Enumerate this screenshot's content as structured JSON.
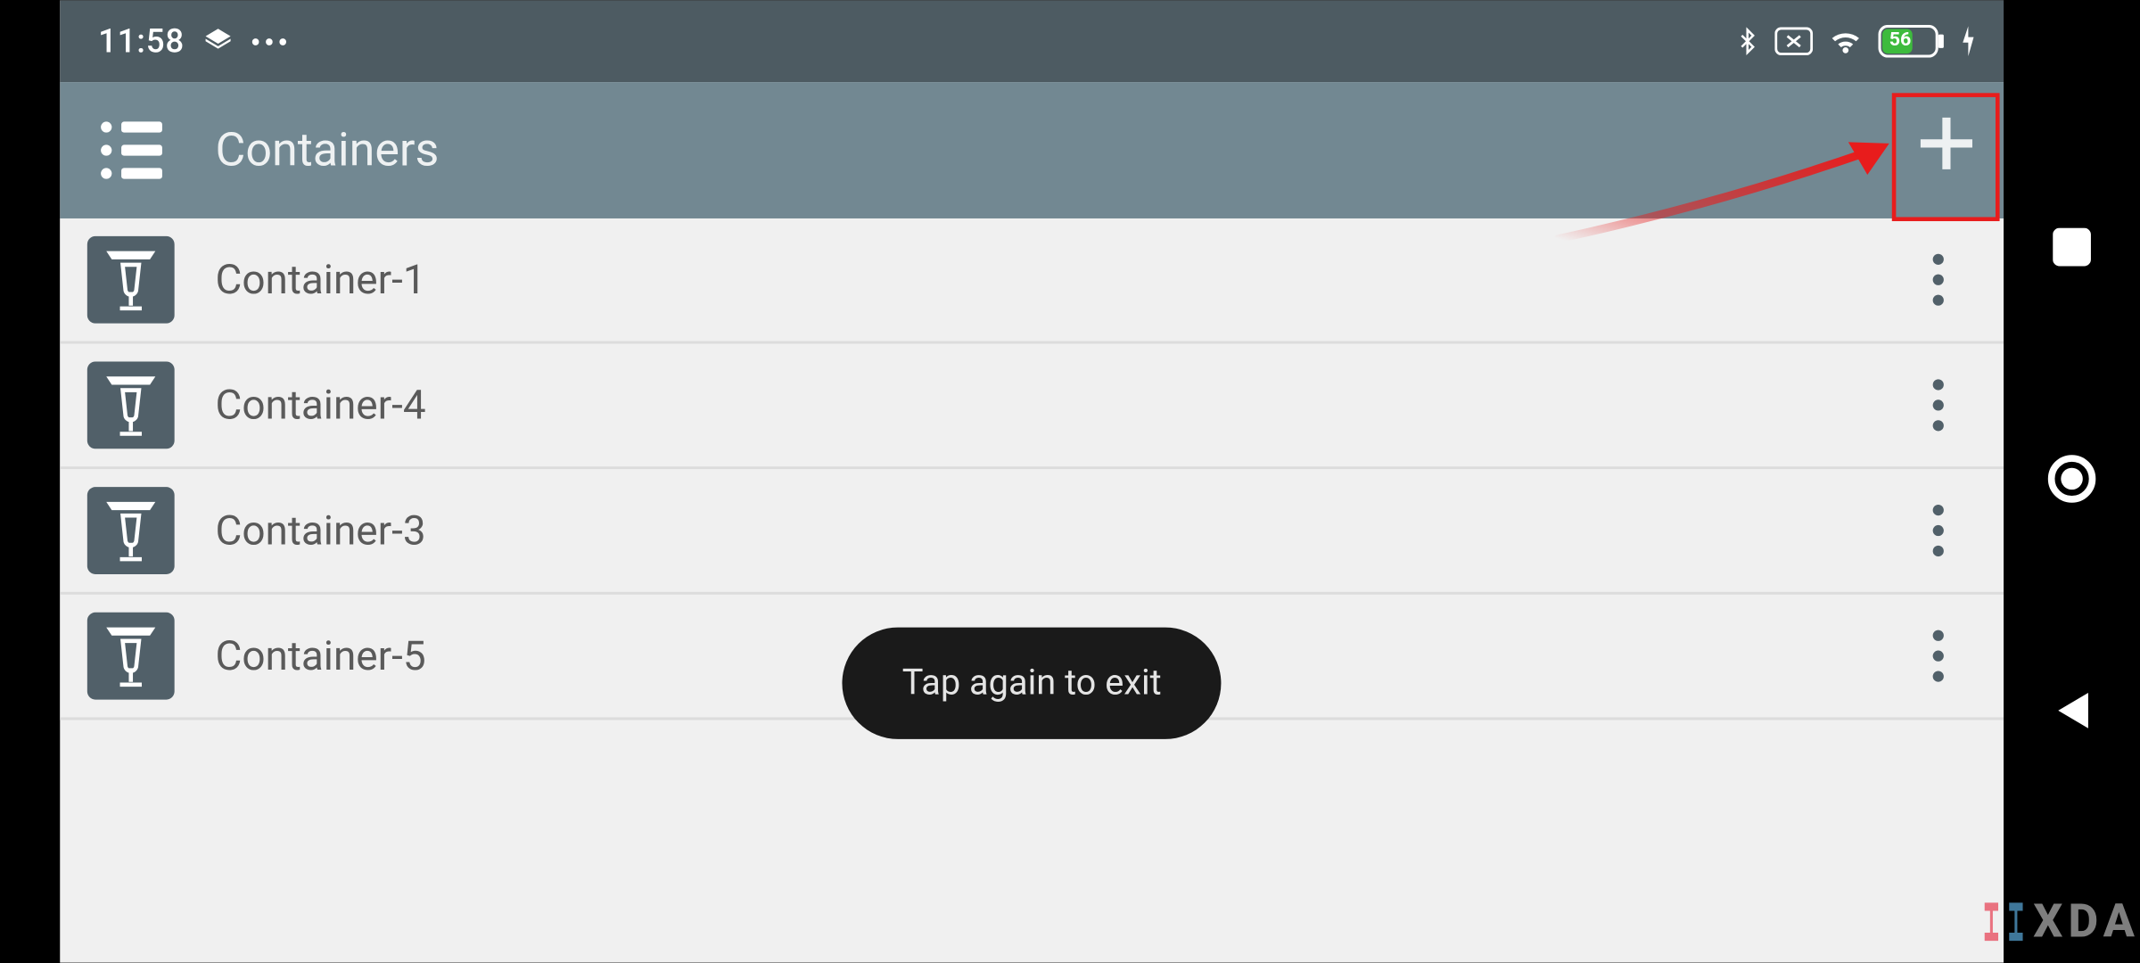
{
  "status": {
    "time": "11:58",
    "battery_percent": "56"
  },
  "appbar": {
    "title": "Containers"
  },
  "list": {
    "items": [
      {
        "label": "Container-1"
      },
      {
        "label": "Container-4"
      },
      {
        "label": "Container-3"
      },
      {
        "label": "Container-5"
      }
    ]
  },
  "toast": {
    "message": "Tap again to exit"
  },
  "watermark": {
    "text": "XDA"
  }
}
